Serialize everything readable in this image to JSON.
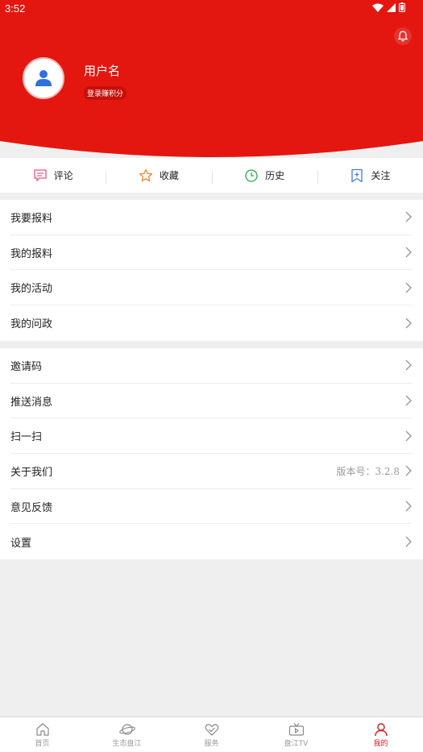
{
  "status_bar": {
    "time": "3:52"
  },
  "profile": {
    "username": "用户名",
    "points_badge": "登录赚积分"
  },
  "quick_actions": [
    {
      "label": "评论",
      "icon": "comment-icon",
      "color": "#e9577a"
    },
    {
      "label": "收藏",
      "icon": "star-icon",
      "color": "#f08a2b"
    },
    {
      "label": "历史",
      "icon": "clock-icon",
      "color": "#2aa84a"
    },
    {
      "label": "关注",
      "icon": "bookmark-icon",
      "color": "#3b7fd6"
    }
  ],
  "menu_group_1": [
    {
      "label": "我要报料"
    },
    {
      "label": "我的报料"
    },
    {
      "label": "我的活动"
    },
    {
      "label": "我的问政"
    }
  ],
  "menu_group_2": [
    {
      "label": "邀请码"
    },
    {
      "label": "推送消息"
    },
    {
      "label": "扫一扫"
    },
    {
      "label": "关于我们",
      "value": "版本号：3.2.8"
    },
    {
      "label": "意见反馈"
    },
    {
      "label": "设置"
    }
  ],
  "bottom_nav": [
    {
      "label": "首页",
      "icon": "home-icon"
    },
    {
      "label": "生态盘江",
      "icon": "planet-icon"
    },
    {
      "label": "服务",
      "icon": "service-heart-icon"
    },
    {
      "label": "盘江TV",
      "icon": "tv-icon"
    },
    {
      "label": "我的",
      "icon": "user-icon",
      "active": true
    }
  ],
  "colors": {
    "brand_red": "#e3170f",
    "active_nav": "#d71a1a"
  }
}
